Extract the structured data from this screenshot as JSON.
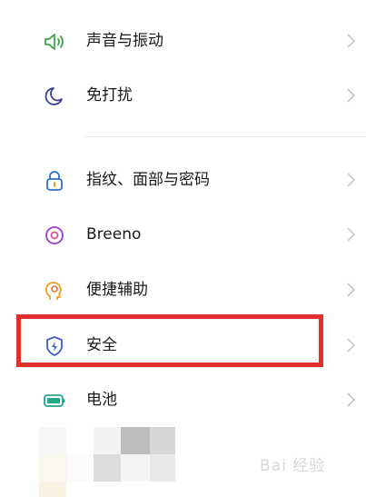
{
  "settings": {
    "items": [
      {
        "label": "声音与振动",
        "icon": "speaker-icon",
        "color": "#3fa34d"
      },
      {
        "label": "免打扰",
        "icon": "moon-icon",
        "color": "#3a3f8f"
      },
      {
        "label": "指纹、面部与密码",
        "icon": "lock-icon",
        "color": "#2f6fd6"
      },
      {
        "label": "Breeno",
        "icon": "breeno-icon",
        "color": "#9b3fd1"
      },
      {
        "label": "便捷辅助",
        "icon": "head-gear-icon",
        "color": "#f0a020"
      },
      {
        "label": "安全",
        "icon": "shield-bolt-icon",
        "color": "#3a5ccf"
      },
      {
        "label": "电池",
        "icon": "battery-icon",
        "color": "#1fa88a"
      }
    ]
  },
  "highlight": {
    "color": "#e0302c",
    "target": "安全"
  },
  "watermark": {
    "text": "Bai 经验"
  }
}
